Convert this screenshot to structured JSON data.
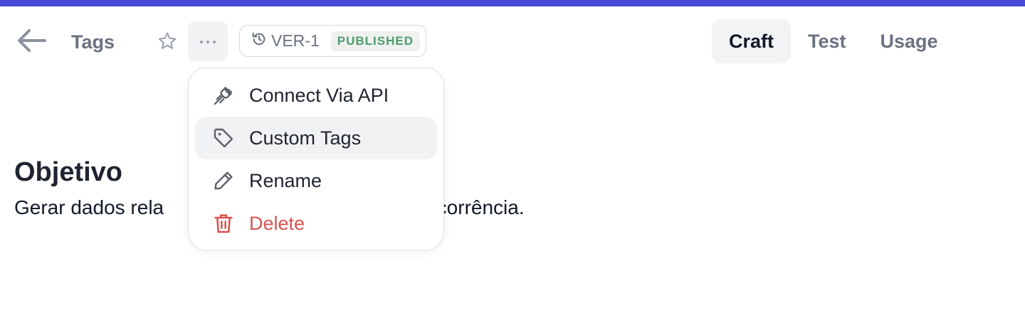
{
  "header": {
    "title": "Tags",
    "version_label": "VER-1",
    "status_badge": "PUBLISHED"
  },
  "tabs": [
    {
      "label": "Craft",
      "active": true
    },
    {
      "label": "Test",
      "active": false
    },
    {
      "label": "Usage",
      "active": false
    }
  ],
  "menu": {
    "items": [
      {
        "label": "Connect Via API",
        "icon": "plug-icon"
      },
      {
        "label": "Custom Tags",
        "icon": "tag-icon"
      },
      {
        "label": "Rename",
        "icon": "pencil-icon"
      },
      {
        "label": "Delete",
        "icon": "trash-icon"
      }
    ]
  },
  "content": {
    "heading": "Objetivo",
    "body_start": "Gerar dados rela",
    "body_end": "ocorrência."
  },
  "colors": {
    "accent_strip": "#4a49d6",
    "published_text": "#4f9a6d",
    "danger": "#d9534f"
  }
}
